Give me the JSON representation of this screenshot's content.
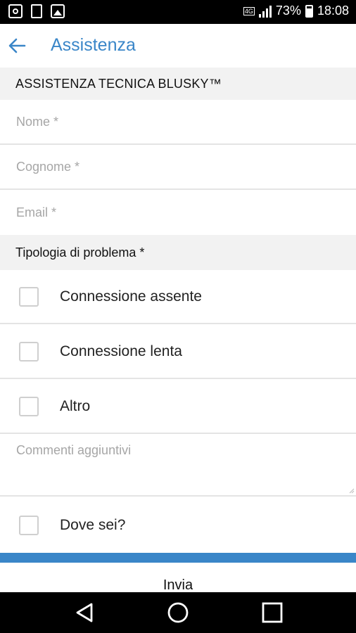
{
  "status_bar": {
    "battery_percent": "73%",
    "time": "18:08",
    "network": "4G",
    "icons": [
      "camera-icon",
      "document-icon",
      "image-icon"
    ]
  },
  "app_bar": {
    "title": "Assistenza",
    "back_icon": "arrow-left-icon"
  },
  "form": {
    "section_title": "ASSISTENZA TECNICA BLUSKY™",
    "fields": {
      "nome_placeholder": "Nome *",
      "cognome_placeholder": "Cognome *",
      "email_placeholder": "Email *"
    },
    "problem_section_title": "Tipologia di problema *",
    "problem_options": [
      {
        "label": "Connessione assente",
        "checked": false
      },
      {
        "label": "Connessione lenta",
        "checked": false
      },
      {
        "label": "Altro",
        "checked": false
      }
    ],
    "comments_placeholder": "Commenti aggiuntivi",
    "location_option": {
      "label": "Dove sei?",
      "checked": false
    },
    "submit_label": "Invia"
  },
  "colors": {
    "accent": "#3a86c8",
    "section_bg": "#f2f2f2",
    "divider": "#e4e4e4",
    "placeholder": "#a6a6a6"
  },
  "nav_bar": {
    "icons": [
      "back-triangle-icon",
      "home-circle-icon",
      "recents-square-icon"
    ]
  }
}
